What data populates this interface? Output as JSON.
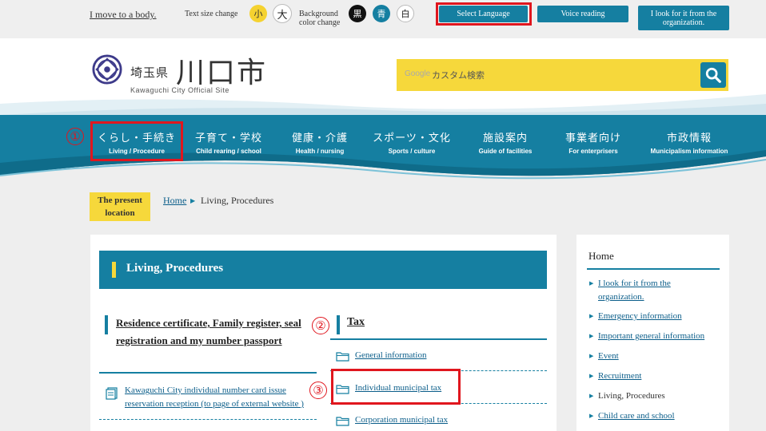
{
  "topbar": {
    "move_to_body": "I move to a body.",
    "text_size_label": "Text size change",
    "size_small": "小",
    "size_large": "大",
    "bg_color_label": "Background color change",
    "bg_black": "黒",
    "bg_blue": "青",
    "bg_white": "白",
    "select_language": "Select Language",
    "voice_reading": "Voice reading",
    "look_for_org": "I look for it from the organization."
  },
  "header": {
    "prefecture": "埼玉県",
    "city": "川口市",
    "subtitle": "Kawaguchi City Official Site",
    "search_brand": "Google",
    "search_placeholder": "カスタム検索"
  },
  "nav": {
    "items": [
      {
        "jp": "くらし・手続き",
        "en": "Living / Procedure"
      },
      {
        "jp": "子育て・学校",
        "en": "Child rearing / school"
      },
      {
        "jp": "健康・介護",
        "en": "Health / nursing"
      },
      {
        "jp": "スポーツ・文化",
        "en": "Sports / culture"
      },
      {
        "jp": "施設案内",
        "en": "Guide of facilities"
      },
      {
        "jp": "事業者向け",
        "en": "For enterprisers"
      },
      {
        "jp": "市政情報",
        "en": "Municipalism information"
      }
    ]
  },
  "annotations": {
    "n1": "①",
    "n2": "②",
    "n3": "③"
  },
  "breadcrumb": {
    "present_label": "The present location",
    "home": "Home",
    "current": "Living, Procedures"
  },
  "main": {
    "title": "Living, Procedures",
    "left_section": {
      "title": "Residence certificate, Family register, seal registration and my number passport",
      "links": [
        "Kawaguchi City individual number card issue reservation reception (to page of external website )"
      ]
    },
    "right_section": {
      "title": "Tax",
      "links": [
        "General information",
        "Individual municipal tax",
        "Corporation municipal tax"
      ]
    }
  },
  "side": {
    "heading": "Home",
    "items": [
      "I look for it from the organization.",
      "Emergency information",
      "Important general information",
      "Event",
      "Recruitment",
      "Living, Procedures",
      "Child care and school"
    ],
    "current_item": "Living, Procedures"
  },
  "colors": {
    "accent": "#157fa1",
    "yellow": "#f6d83b",
    "highlight_red": "#e0161e",
    "link": "#0b5e8a"
  }
}
